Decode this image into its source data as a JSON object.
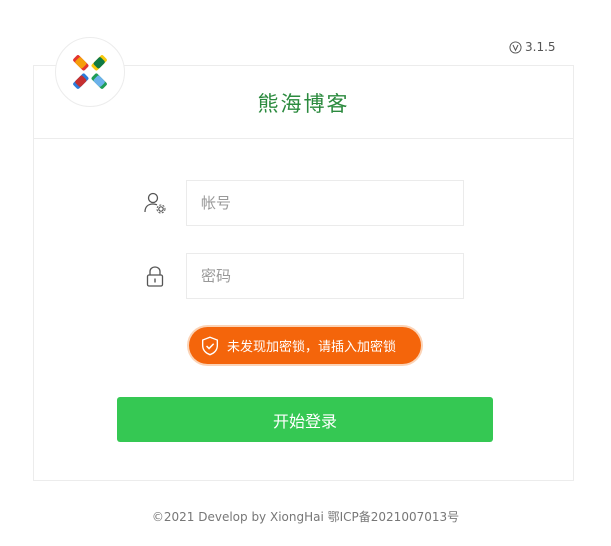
{
  "version": "3.1.5",
  "header": {
    "title": "熊海博客"
  },
  "form": {
    "username_placeholder": "帐号",
    "password_placeholder": "密码",
    "alert_text": "未发现加密锁，请插入加密锁",
    "submit_label": "开始登录"
  },
  "footer": {
    "text": "©2021 Develop by XiongHai 鄂ICP备2021007013号"
  },
  "colors": {
    "title_green": "#2b8a3e",
    "alert_orange": "#f4650b",
    "button_green": "#35c853"
  },
  "icons": {
    "logo": "colorful-x-logo-icon",
    "version": "v-circle-icon",
    "username": "user-gear-icon",
    "password": "lock-icon",
    "alert": "shield-check-icon"
  }
}
